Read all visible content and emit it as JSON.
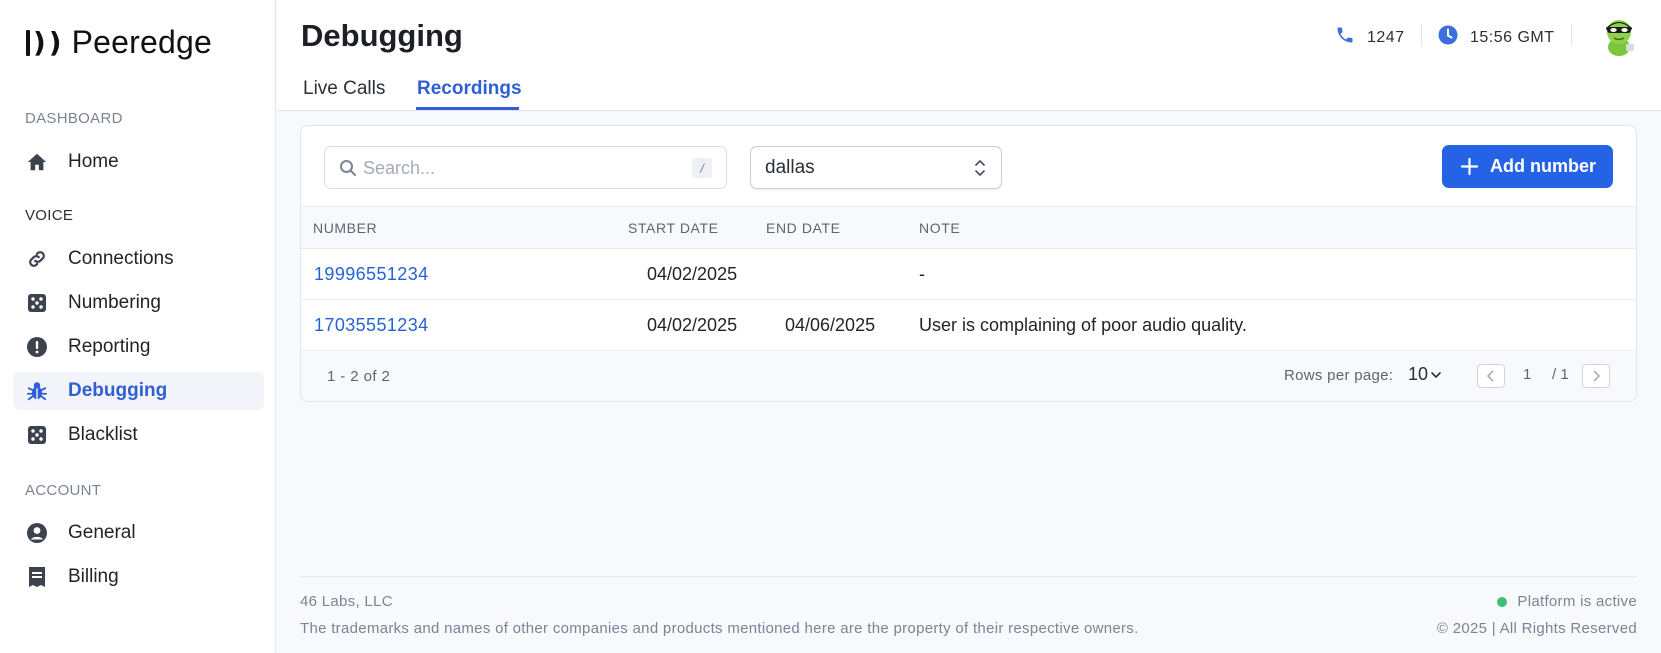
{
  "app": {
    "name": "Peeredge"
  },
  "sidebar": {
    "sections": [
      {
        "label": "DASHBOARD",
        "items": [
          {
            "label": "Home",
            "icon": "home-icon"
          }
        ]
      },
      {
        "label": "VOICE",
        "items": [
          {
            "label": "Connections",
            "icon": "link-icon"
          },
          {
            "label": "Numbering",
            "icon": "dice-icon"
          },
          {
            "label": "Reporting",
            "icon": "alert-circle-icon"
          },
          {
            "label": "Debugging",
            "icon": "bug-icon",
            "active": true
          },
          {
            "label": "Blacklist",
            "icon": "dice-icon"
          }
        ]
      },
      {
        "label": "ACCOUNT",
        "items": [
          {
            "label": "General",
            "icon": "user-circle-icon"
          },
          {
            "label": "Billing",
            "icon": "receipt-icon"
          }
        ]
      }
    ]
  },
  "header": {
    "title": "Debugging",
    "tabs": [
      {
        "label": "Live Calls"
      },
      {
        "label": "Recordings",
        "active": true
      }
    ],
    "calls_count": "1247",
    "time": "15:56 GMT"
  },
  "toolbar": {
    "search_placeholder": "Search...",
    "search_shortcut": "/",
    "select_value": "dallas",
    "add_label": "Add number"
  },
  "table": {
    "columns": [
      "NUMBER",
      "START DATE",
      "END DATE",
      "NOTE"
    ],
    "rows": [
      {
        "number": "19996551234",
        "start": "04/02/2025",
        "end": "",
        "note": "-"
      },
      {
        "number": "17035551234",
        "start": "04/02/2025",
        "end": "04/06/2025",
        "note": "User is complaining of poor audio quality."
      }
    ]
  },
  "pagination": {
    "range": "1 - 2 of 2",
    "rows_per_page_label": "Rows per page:",
    "rows_per_page": "10",
    "current_page": "1",
    "total_pages": "/ 1"
  },
  "footer": {
    "company": "46 Labs, LLC",
    "legal": "The trademarks and names of other companies and products mentioned here are the property of their respective owners.",
    "status": "Platform is active",
    "copyright": "© 2025 | All Rights Reserved"
  },
  "colors": {
    "accent": "#2563e6",
    "link": "#2563d4",
    "status_ok": "#3fbe7a"
  }
}
